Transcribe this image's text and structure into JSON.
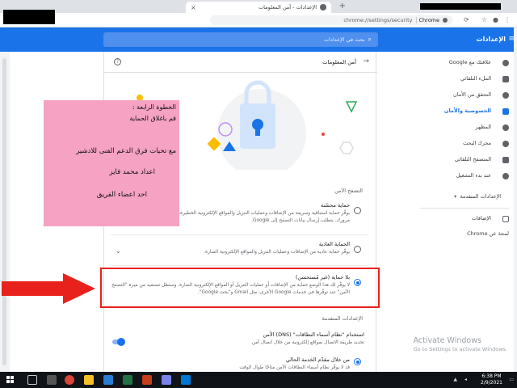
{
  "browser": {
    "tab_title": "الإعدادات - أمن المعلومات",
    "tab_close": "×",
    "new_tab": "+",
    "url": "chrome://settings/security",
    "site_label": "Chrome"
  },
  "header": {
    "title": "الإعدادات",
    "search_placeholder": "بحث في الإعدادات"
  },
  "sidebar": {
    "items": [
      {
        "label": "علاقتك مع Google",
        "icon": "person-icon"
      },
      {
        "label": "الملء التلقائي",
        "icon": "autofill-icon"
      },
      {
        "label": "التحقق من الأمان",
        "icon": "shield-check-icon"
      },
      {
        "label": "الخصوصية والأمان",
        "icon": "shield-icon",
        "active": true
      },
      {
        "label": "المظهر",
        "icon": "palette-icon"
      },
      {
        "label": "محرك البحث",
        "icon": "search-icon"
      },
      {
        "label": "المتصفح التلقائي",
        "icon": "browser-icon"
      },
      {
        "label": "عند بدء التشغيل",
        "icon": "power-icon"
      }
    ],
    "advanced": "الإعدادات المتقدمة",
    "extensions": "الإضافات",
    "about": "لمحة عن Chrome"
  },
  "card": {
    "title": "أمن المعلومات",
    "safe_browsing_label": "التصفح الآمن",
    "options": [
      {
        "title": "حماية محسّنة",
        "desc": "يوفّر حماية استباقية وسريعة من الإضافات وعمليات التنزيل والمواقع الإلكترونية الخطيرة. يحذّرك عند حدوث انتهاك لكلمة مرورك. يتطلب إرسال بيانات التصفح إلى Google.",
        "selected": false
      },
      {
        "title": "الحماية العادية",
        "desc": "يوفّر حماية عادية من الإضافات وعمليات التنزيل والمواقع الإلكترونية الضارة.",
        "selected": false
      },
      {
        "title": "بلا حماية (غير مُستحسَن)",
        "desc": "لا يوفّر لك هذا الوضع حماية من الإضافات أو عمليات التنزيل أو المواقع الإلكترونية الضارة. وستظل تستفيد من ميزة \"التصفح الآمن\" عند توفّرها في خدمات Google الأخرى، مثل Gmail و\"بحث Google\".",
        "selected": true
      }
    ],
    "advanced_label": "الإعدادات المتقدمة",
    "dns": {
      "title": "استخدام \"نظام أسماء النطاقات\" (DNS) الآمن",
      "desc": "تحديد طريقة الاتصال بمواقع إلكترونية من خلال اتصال آمن"
    },
    "provider": {
      "title": "من خلال مقدّم الخدمة الحالي",
      "desc": "قد لا يوفّر نظام أسماء النطاقات الآمن متاحًا طوال الوقت"
    }
  },
  "note": {
    "lines": [
      "الخطوة الرابعة :",
      "قم باغلاق الحماية",
      "مع تحيات فرق الدعم الفنى للادشير",
      "اعداد محمد فايز",
      "احد اعضاء الفريق"
    ]
  },
  "watermark": {
    "title": "Activate Windows",
    "subtitle": "Go to Settings to activate Windows."
  },
  "taskbar": {
    "time": "6:38 PM",
    "date": "2/9/2021"
  },
  "colors": {
    "accent": "#1a73e8",
    "highlight": "#e8211c",
    "note": "#f5a2c3"
  }
}
